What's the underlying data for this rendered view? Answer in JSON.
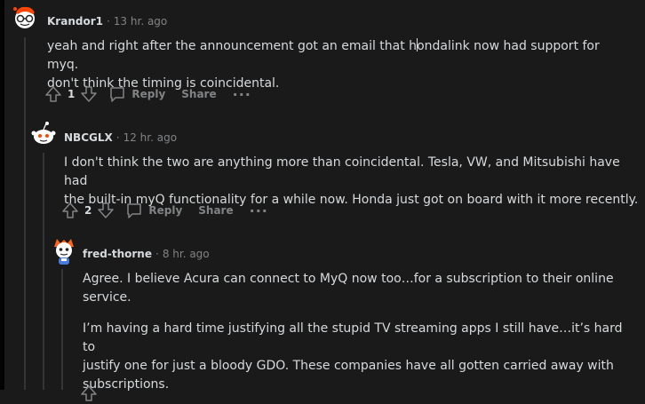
{
  "comments": [
    {
      "username": "Krandor1",
      "time": "13 hr. ago",
      "body_before_cursor": "yeah and right after the announcement got an email that h",
      "body_after_cursor": "ondalink now had support for myq.",
      "body_line2": "don't think the timing is coincidental.",
      "score": "1",
      "reply_label": "Reply",
      "share_label": "Share",
      "more_label": "···",
      "avatar_icon": "snoo-avatar-glasses-icon"
    },
    {
      "username": "NBCGLX",
      "time": "12 hr. ago",
      "body_line1": "I don't think the two are anything more than coincidental. Tesla, VW, and Mitsubishi have had",
      "body_line2": "the built-in myQ functionality for a while now. Honda just got on board with it more recently.",
      "score": "2",
      "reply_label": "Reply",
      "share_label": "Share",
      "more_label": "···",
      "avatar_icon": "snoo-avatar-default-icon"
    },
    {
      "username": "fred-thorne",
      "time": "8 hr. ago",
      "para1_line1": "Agree. I believe Acura can connect to MyQ now too…for a subscription to their online",
      "para1_line2": "service.",
      "para2_line1": "I’m having a hard time justifying all the stupid TV streaming apps I still have…it’s hard to",
      "para2_line2": "justify one for just a bloody GDO. These companies have all gotten carried away with",
      "para2_line3": "subscriptions.",
      "avatar_icon": "snoo-avatar-fox-hat-icon"
    }
  ],
  "separator": "·",
  "colors": {
    "background": "#1a1a1b",
    "text": "#d7dadc",
    "muted": "#818384",
    "thread_line": "#343536"
  }
}
